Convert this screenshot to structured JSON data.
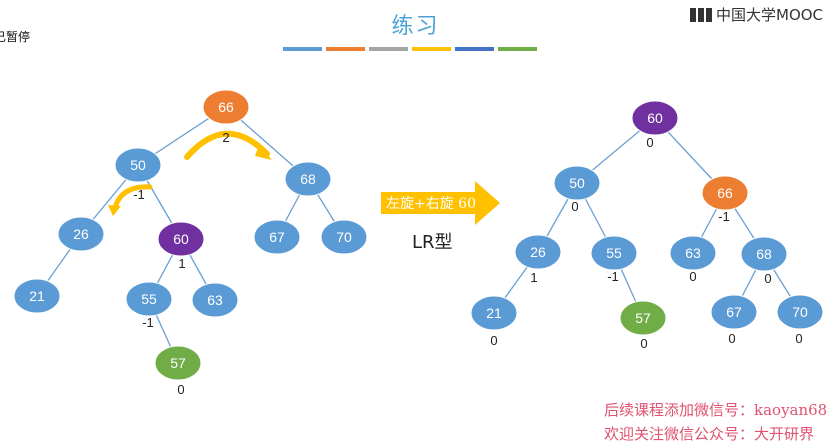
{
  "status_text": "已暂停",
  "title": "练习",
  "logo_text": "中国大学MOOC",
  "stripe_colors": [
    "#5b9bd5",
    "#ed7d31",
    "#a5a5a5",
    "#ffc000",
    "#4472c4",
    "#70ad47"
  ],
  "left_tree": {
    "nodes": [
      {
        "key": "66",
        "color": "orange"
      },
      {
        "key": "50",
        "color": "blue"
      },
      {
        "key": "68",
        "color": "blue"
      },
      {
        "key": "26",
        "color": "blue"
      },
      {
        "key": "60",
        "color": "purple",
        "balance": "1"
      },
      {
        "key": "67",
        "color": "blue"
      },
      {
        "key": "70",
        "color": "blue"
      },
      {
        "key": "21",
        "color": "blue"
      },
      {
        "key": "55",
        "color": "blue",
        "balance": "-1"
      },
      {
        "key": "63",
        "color": "blue"
      },
      {
        "key": "57",
        "color": "green",
        "balance": "0"
      }
    ],
    "rotation_labels": {
      "top": "2",
      "inner": "-1"
    }
  },
  "transition": {
    "arrow_label": "左旋+右旋 60",
    "type_label": "LR型"
  },
  "right_tree": {
    "nodes": [
      {
        "key": "60",
        "color": "purple",
        "balance": "0"
      },
      {
        "key": "50",
        "color": "blue",
        "balance": "0"
      },
      {
        "key": "66",
        "color": "orange",
        "balance": "-1"
      },
      {
        "key": "26",
        "color": "blue",
        "balance": "1"
      },
      {
        "key": "55",
        "color": "blue",
        "balance": "-1"
      },
      {
        "key": "63",
        "color": "blue",
        "balance": "0"
      },
      {
        "key": "68",
        "color": "blue",
        "balance": "0"
      },
      {
        "key": "21",
        "color": "blue",
        "balance": "0"
      },
      {
        "key": "57",
        "color": "green",
        "balance": "0"
      },
      {
        "key": "67",
        "color": "blue",
        "balance": "0"
      },
      {
        "key": "70",
        "color": "blue",
        "balance": "0"
      }
    ]
  },
  "footer": {
    "line1": "后续课程添加微信号：kaoyan68",
    "line2": "欢迎关注微信公众号：大开研界"
  },
  "colors": {
    "blue": "#5b9bd5",
    "orange": "#ed7d31",
    "purple": "#7030a0",
    "green": "#70ad47",
    "edge": "#6a9fd1",
    "arrow": "#ffc000"
  }
}
